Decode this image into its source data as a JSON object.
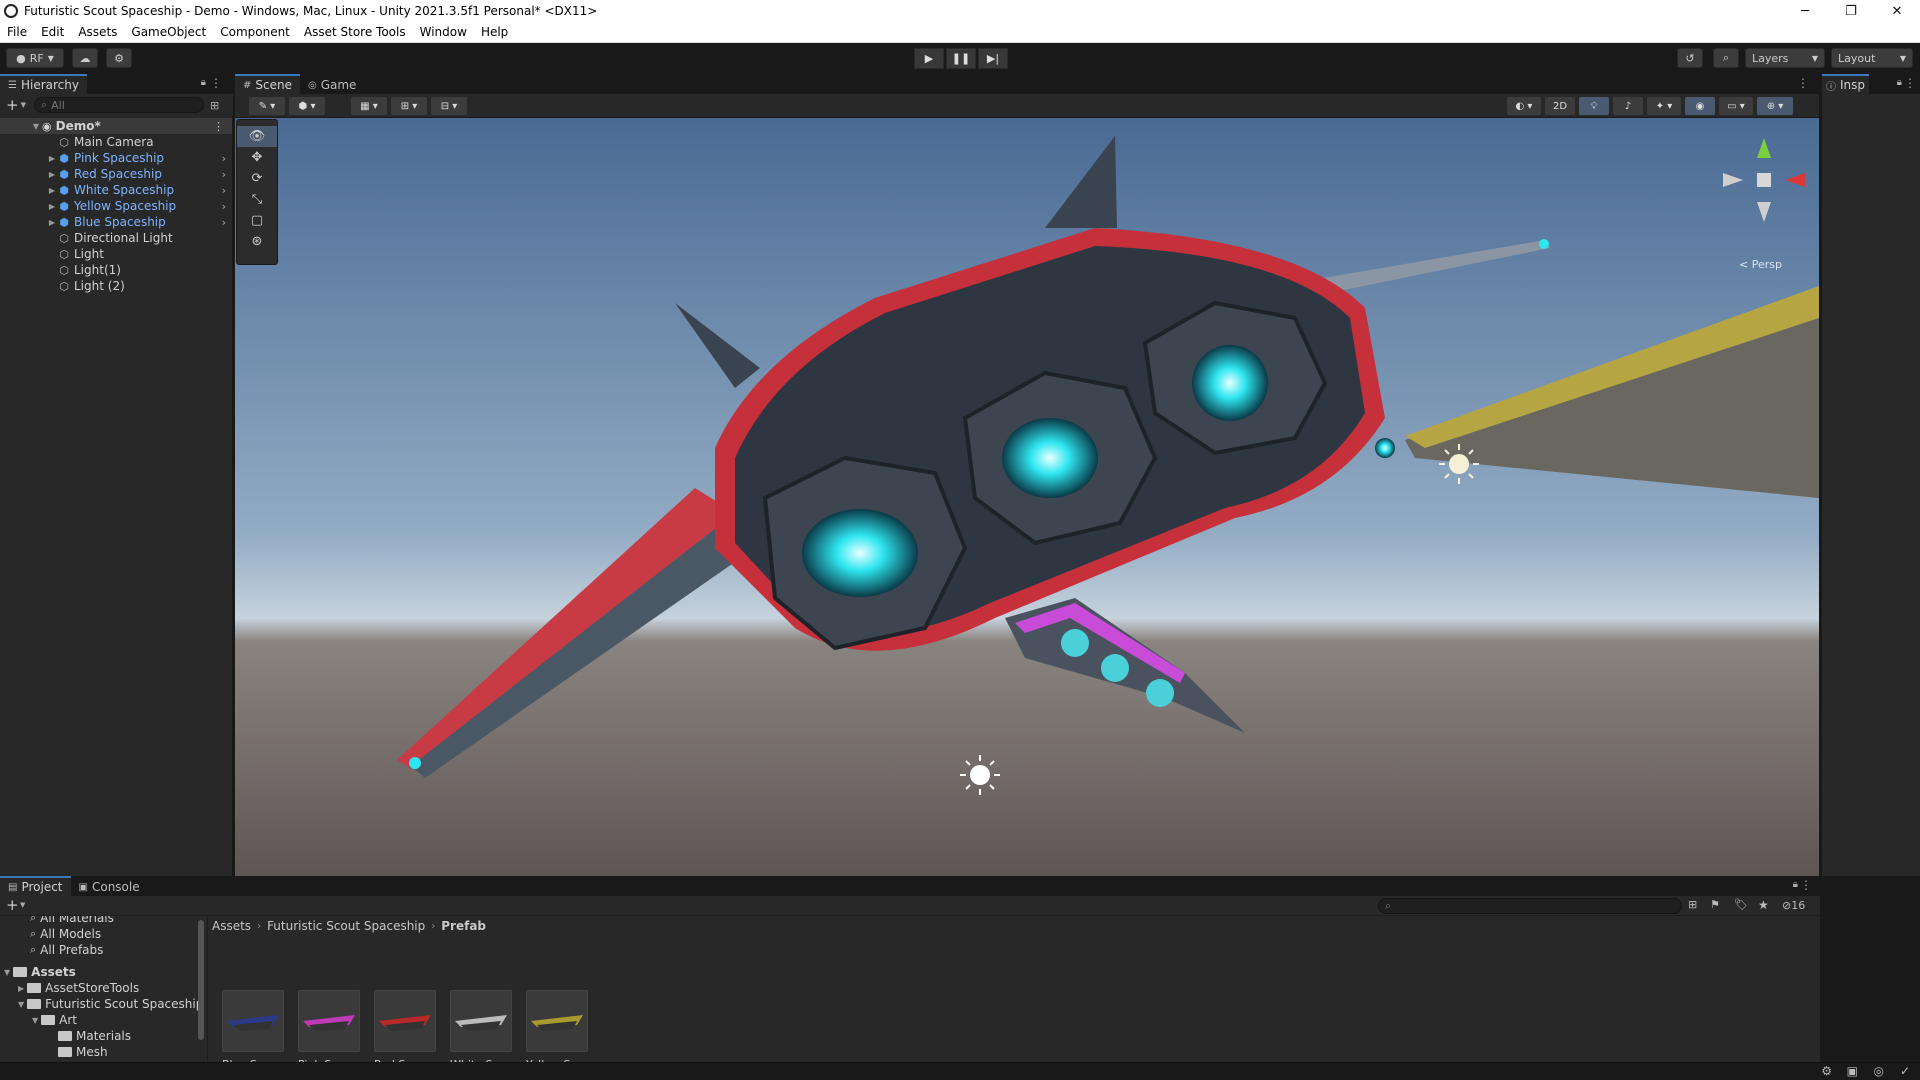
{
  "window": {
    "title": "Futuristic Scout Spaceship - Demo - Windows, Mac, Linux - Unity 2021.3.5f1 Personal* <DX11>",
    "minimize": "─",
    "maximize": "❐",
    "close": "✕"
  },
  "menu": [
    "File",
    "Edit",
    "Assets",
    "GameObject",
    "Component",
    "Asset Store Tools",
    "Window",
    "Help"
  ],
  "toolbar": {
    "account": "RF",
    "layers": "Layers",
    "layout": "Layout"
  },
  "hierarchy": {
    "tab": "Hierarchy",
    "search_placeholder": "All",
    "scene": "Demo*",
    "items": [
      {
        "label": "Main Camera",
        "prefab": false,
        "expandable": false
      },
      {
        "label": "Pink Spaceship",
        "prefab": true,
        "expandable": true
      },
      {
        "label": "Red Spaceship",
        "prefab": true,
        "expandable": true
      },
      {
        "label": "White Spaceship",
        "prefab": true,
        "expandable": true
      },
      {
        "label": "Yellow Spaceship",
        "prefab": true,
        "expandable": true
      },
      {
        "label": "Blue Spaceship",
        "prefab": true,
        "expandable": true
      },
      {
        "label": "Directional Light",
        "prefab": false,
        "expandable": false
      },
      {
        "label": "Light",
        "prefab": false,
        "expandable": false
      },
      {
        "label": "Light(1)",
        "prefab": false,
        "expandable": false
      },
      {
        "label": "Light (2)",
        "prefab": false,
        "expandable": false
      }
    ]
  },
  "scene_view": {
    "tabs": [
      "Scene",
      "Game"
    ],
    "mode_2d": "2D",
    "projection": "< Persp"
  },
  "inspector": {
    "tab": "Insp"
  },
  "project": {
    "tabs": [
      "Project",
      "Console"
    ],
    "visible_count": "16",
    "tree": [
      {
        "label": "All Materials",
        "kind": "search"
      },
      {
        "label": "All Models",
        "kind": "search"
      },
      {
        "label": "All Prefabs",
        "kind": "search"
      },
      {
        "label": "Assets",
        "kind": "folder-root"
      },
      {
        "label": "AssetStoreTools",
        "kind": "folder"
      },
      {
        "label": "Futuristic Scout Spaceship",
        "kind": "folder"
      },
      {
        "label": "Art",
        "kind": "folder"
      },
      {
        "label": "Materials",
        "kind": "folder"
      },
      {
        "label": "Mesh",
        "kind": "folder"
      }
    ],
    "breadcrumb": [
      "Assets",
      "Futuristic Scout Spaceship",
      "Prefab"
    ],
    "assets": [
      {
        "label": "Blue Spac...",
        "color": "#2a3a88"
      },
      {
        "label": "Pink Space...",
        "color": "#c03ab8"
      },
      {
        "label": "Red Space...",
        "color": "#b82a2a"
      },
      {
        "label": "White Spa...",
        "color": "#bbbbbb"
      },
      {
        "label": "Yellow Spa...",
        "color": "#a89a30"
      }
    ]
  },
  "colors": {
    "accent": "#3a79bb",
    "prefab_text": "#7cb4ff",
    "engine_glow": "#2ee6f0"
  }
}
